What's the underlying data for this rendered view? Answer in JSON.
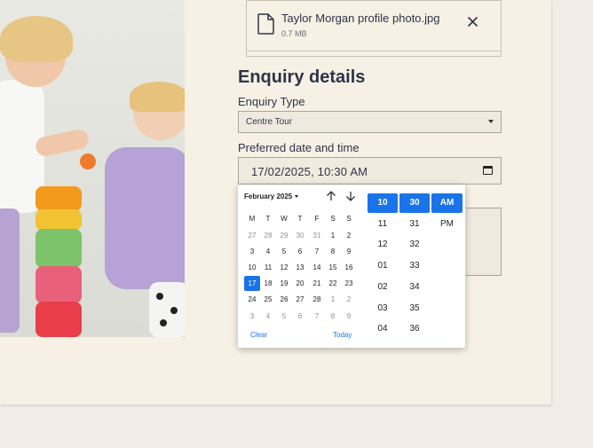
{
  "file_upload": {
    "file_name": "Taylor Morgan profile photo.jpg",
    "file_size": "0.7 MB"
  },
  "section_title": "Enquiry details",
  "enquiry_type": {
    "label": "Enquiry Type",
    "value": "Centre Tour"
  },
  "preferred_datetime": {
    "label": "Preferred date and time",
    "value": "17/02/2025, 10:30 AM"
  },
  "picker": {
    "month_label": "February 2025",
    "weekdays": [
      "M",
      "T",
      "W",
      "T",
      "F",
      "S",
      "S"
    ],
    "weeks": [
      [
        "27",
        "28",
        "29",
        "30",
        "31",
        "1",
        "2"
      ],
      [
        "3",
        "4",
        "5",
        "6",
        "7",
        "8",
        "9"
      ],
      [
        "10",
        "11",
        "12",
        "13",
        "14",
        "15",
        "16"
      ],
      [
        "17",
        "18",
        "19",
        "20",
        "21",
        "22",
        "23"
      ],
      [
        "24",
        "25",
        "26",
        "27",
        "28",
        "1",
        "2"
      ],
      [
        "3",
        "4",
        "5",
        "6",
        "7",
        "8",
        "9"
      ]
    ],
    "selected_day": "17",
    "clear_label": "Clear",
    "today_label": "Today",
    "hours": [
      "10",
      "11",
      "12",
      "01",
      "02",
      "03",
      "04"
    ],
    "minutes": [
      "30",
      "31",
      "32",
      "33",
      "34",
      "35",
      "36"
    ],
    "periods": [
      "AM",
      "PM"
    ],
    "selected_hour": "10",
    "selected_minute": "30",
    "selected_period": "AM"
  },
  "colors": {
    "accent": "#1a73e8",
    "card_bg": "#f6f1e4",
    "page_bg": "#f2ebe6",
    "text": "#2f3349"
  }
}
